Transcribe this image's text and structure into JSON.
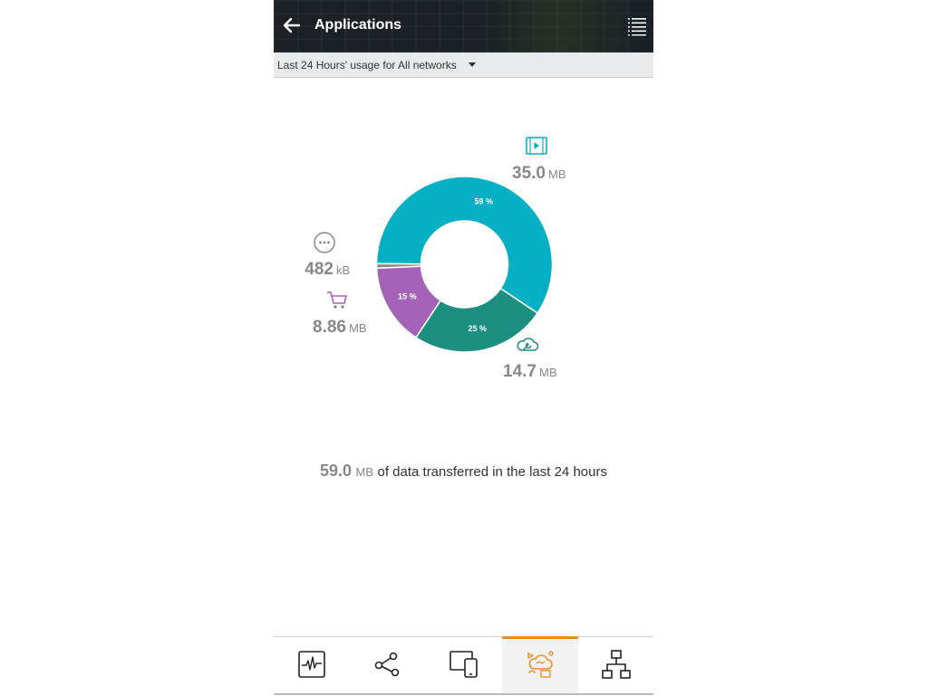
{
  "header": {
    "title": "Applications",
    "back_icon": "arrow-left-icon",
    "menu_icon": "list-icon"
  },
  "filter": {
    "label": "Last 24 Hours' usage for All networks"
  },
  "chart_data": {
    "type": "pie",
    "donut": true,
    "slices": [
      {
        "category": "streaming",
        "icon": "video-icon",
        "percent_label": "59 %",
        "value": "35.0",
        "unit": "MB",
        "color": "#06b0c4",
        "fraction": 0.593
      },
      {
        "category": "cloud-utility",
        "icon": "cloud-wrench-icon",
        "percent_label": "25 %",
        "value": "14.7",
        "unit": "MB",
        "color": "#1b8f82",
        "fraction": 0.249
      },
      {
        "category": "shopping",
        "icon": "cart-icon",
        "percent_label": "15 %",
        "value": "8.86",
        "unit": "MB",
        "color": "#a563b8",
        "fraction": 0.15
      },
      {
        "category": "other",
        "icon": "more-icon",
        "percent_label": "",
        "value": "482",
        "unit": "kB",
        "color": "#888888",
        "fraction": 0.008
      }
    ]
  },
  "summary": {
    "value": "59.0",
    "unit": "MB",
    "text": "of data transferred in the last 24 hours"
  },
  "nav": {
    "items": [
      {
        "name": "activity-icon",
        "active": false
      },
      {
        "name": "network-nodes-icon",
        "active": false
      },
      {
        "name": "devices-icon",
        "active": false
      },
      {
        "name": "applications-icon",
        "active": true
      },
      {
        "name": "topology-icon",
        "active": false
      }
    ],
    "accent": "#f28a22"
  }
}
